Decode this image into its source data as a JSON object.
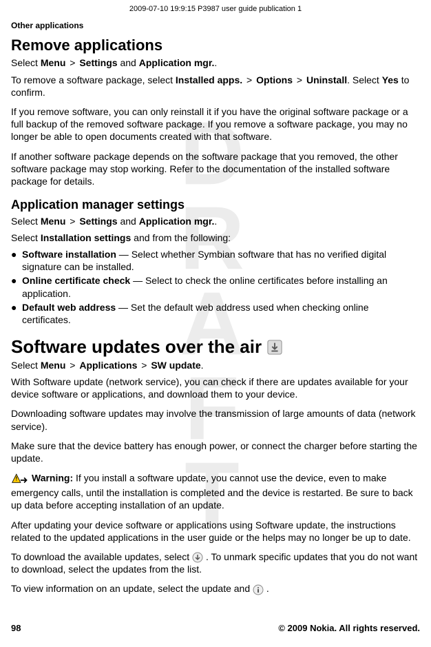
{
  "meta": {
    "topLine": "2009-07-10 19:9:15 P3987 user guide publication 1",
    "watermark": "DRAFT"
  },
  "chapter": "Other applications",
  "section1": {
    "heading": "Remove applications",
    "navPrefix": "Select ",
    "nav": {
      "menu": "Menu",
      "sep": ">",
      "settings": "Settings",
      "and": "and",
      "appMgr": "Application mgr."
    },
    "p1a": "To remove a software package, select ",
    "p1b": "Installed apps.",
    "p1c": "Options",
    "p1d": "Uninstall",
    "p1e": ". Select ",
    "p1f": "Yes",
    "p1g": " to confirm.",
    "p2": "If you remove software, you can only reinstall it if you have the original software package or a full backup of the removed software package. If you remove a software package, you may no longer be able to open documents created with that software.",
    "p3": "If another software package depends on the software package that you removed, the other software package may stop working. Refer to the documentation of the installed software package for details."
  },
  "section2": {
    "heading": "Application manager settings",
    "navPrefix": "Select ",
    "nav": {
      "menu": "Menu",
      "sep": ">",
      "settings": "Settings",
      "and": "and",
      "appMgr": "Application mgr."
    },
    "line2a": "Select ",
    "line2b": "Installation settings",
    "line2c": " and from the following:",
    "items": [
      {
        "label": "Software installation",
        "desc": " — Select whether Symbian software that has no verified digital signature can be installed."
      },
      {
        "label": "Online certificate check",
        "desc": " — Select to check the online certificates before installing an application."
      },
      {
        "label": "Default web address",
        "desc": " — Set the default web address used when checking online certificates."
      }
    ]
  },
  "section3": {
    "heading": "Software updates over the air",
    "navPrefix": "Select ",
    "nav": {
      "menu": "Menu",
      "sep": ">",
      "apps": "Applications",
      "sw": "SW update"
    },
    "p1": "With Software update (network service), you can check if there are updates available for your device software or applications, and download them to your device.",
    "p2": "Downloading software updates may involve the transmission of large amounts of data (network service).",
    "p3": "Make sure that the device battery has enough power, or connect the charger before starting the update.",
    "warningLabel": "Warning:",
    "warningText": "  If you install a software update, you cannot use the device, even to make emergency calls, until the installation is completed and the device is restarted. Be sure to back up data before accepting installation of an update.",
    "p4": "After updating your device software or applications using Software update, the instructions related to the updated applications in the user guide or the helps may no longer be up to date.",
    "p5a": "To download the available updates, select ",
    "p5b": " . To unmark specific updates that you do not want to download, select the updates from the list.",
    "p6a": "To view information on an update, select the update and ",
    "p6b": " ."
  },
  "footer": {
    "pageNum": "98",
    "copyright": "© 2009 Nokia. All rights reserved."
  }
}
